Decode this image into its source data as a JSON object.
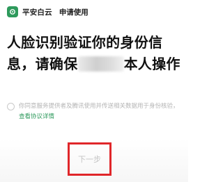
{
  "header": {
    "app_name": "平安白云",
    "subtitle": "申请使用"
  },
  "main": {
    "headline_part1": "人脸识别验证你的身份信息，请确保",
    "headline_part2": "本人操作"
  },
  "consent": {
    "text": "你同意服务提供者及腾讯使用并传送相关数据用于身份核验，",
    "link": "查看协议详情"
  },
  "actions": {
    "next_label": "下一步"
  },
  "colors": {
    "accent": "#2e9a5c",
    "highlight_border": "#e0262a",
    "disabled_text": "#c4c4c4"
  }
}
